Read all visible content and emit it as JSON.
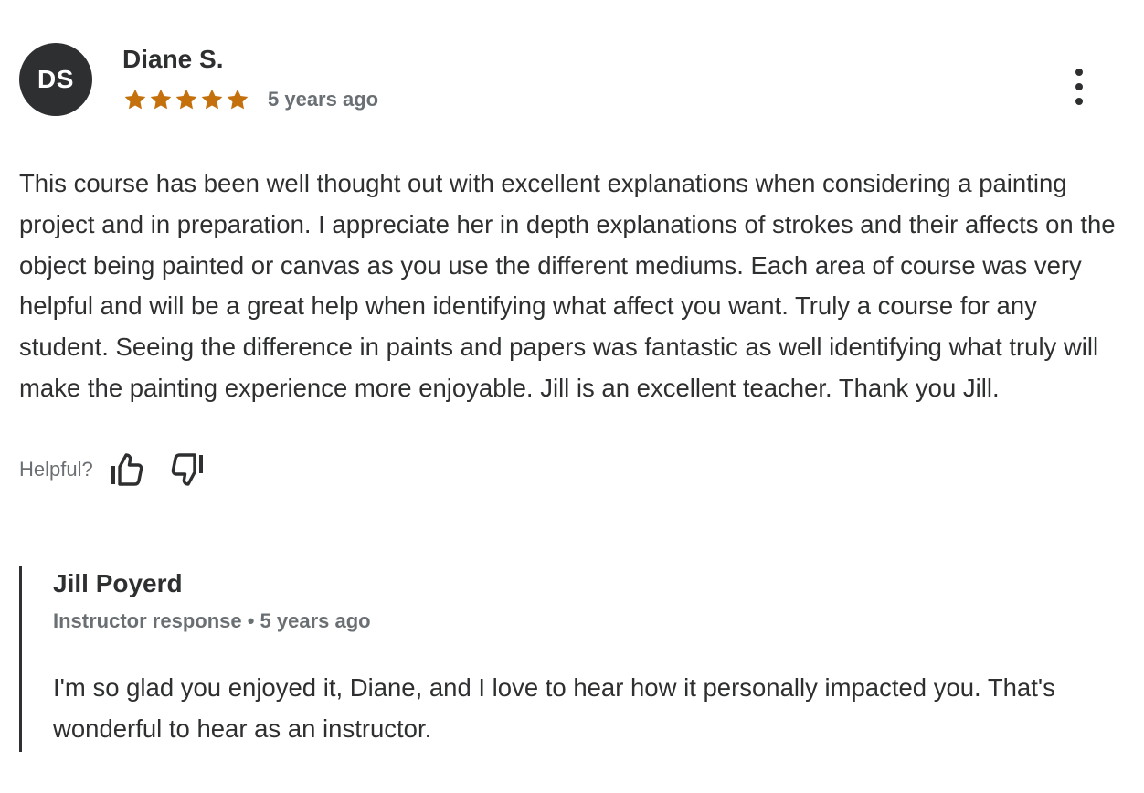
{
  "review": {
    "avatar_initials": "DS",
    "reviewer_name": "Diane S.",
    "rating": 5,
    "rating_max": 5,
    "star_color": "#c4710d",
    "date": "5 years ago",
    "more_icon": "more-vertical-icon",
    "body": "This course has been well thought out with excellent explanations when considering a painting project and in preparation. I appreciate her in depth explanations of strokes and their affects on the object being painted or canvas as you use the different mediums. Each area of course was very helpful and will be a great help when identifying what affect you want. Truly a course for any student. Seeing the difference in paints and papers was fantastic as well identifying what truly will make the painting experience more enjoyable. Jill is an excellent teacher. Thank you Jill.",
    "helpful_label": "Helpful?",
    "thumbs_up_icon": "thumbs-up-icon",
    "thumbs_down_icon": "thumbs-down-icon"
  },
  "response": {
    "responder_name": "Jill Poyerd",
    "role": "Instructor response",
    "separator": " • ",
    "date": "5 years ago",
    "body": "I'm so glad you enjoyed it, Diane, and I love to hear how it personally impacted you. That's wonderful to hear as an instructor."
  },
  "colors": {
    "text": "#2d2f31",
    "muted": "#6a6f73",
    "avatar_bg": "#2d2f31",
    "accent_star": "#c4710d"
  }
}
